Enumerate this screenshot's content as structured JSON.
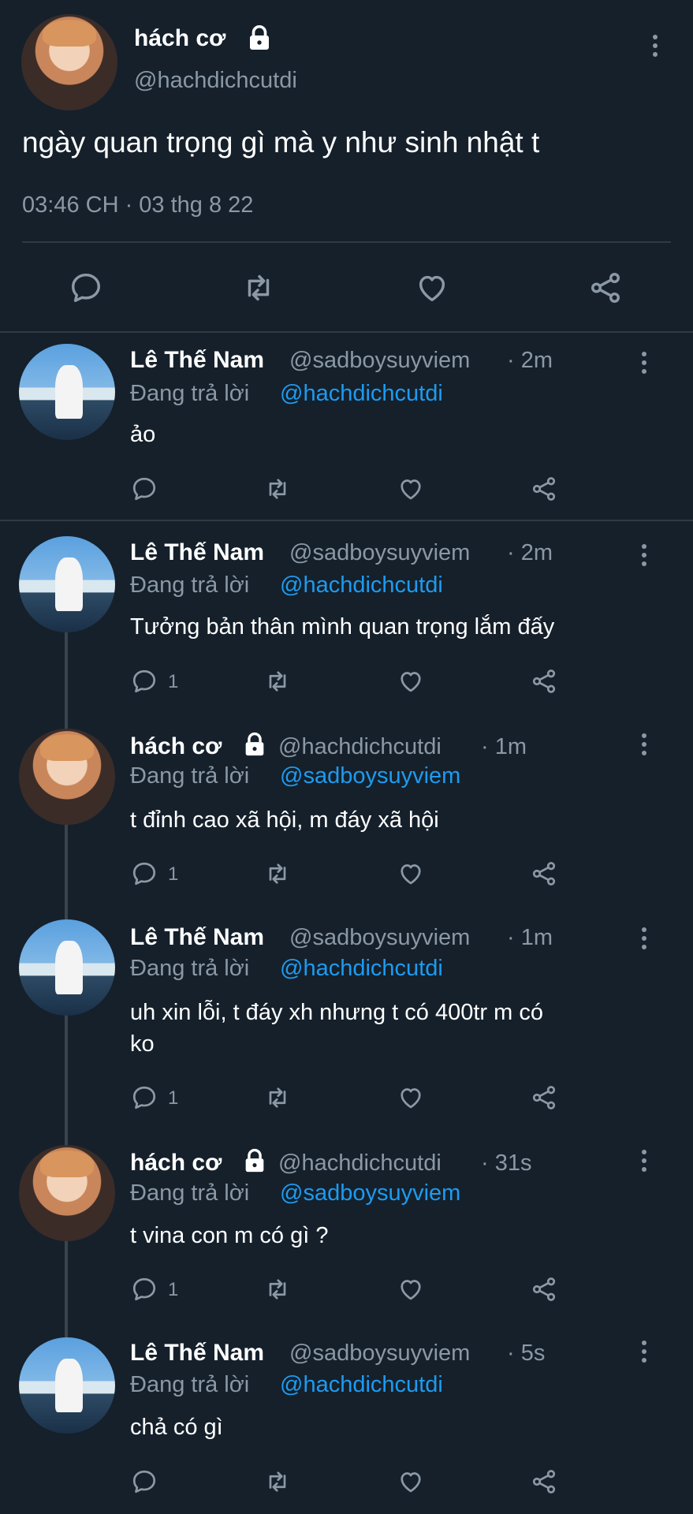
{
  "main_tweet": {
    "name": "hách cơ",
    "handle": "@hachdichcutdi",
    "text": "ngày quan trọng gì mà y như sinh nhật t",
    "timestamp": "03:46 CH · 03 thg 8 22",
    "more_icon": "more-vertical-icon",
    "lock_icon": "lock-icon"
  },
  "actions": {
    "reply_icon": "reply-icon",
    "retweet_icon": "retweet-icon",
    "like_icon": "heart-icon",
    "share_icon": "share-icon"
  },
  "colors": {
    "background": "#15202b",
    "muted": "#8b98a5",
    "link": "#1d9bf0",
    "separator": "#2f3a45"
  },
  "replies": [
    {
      "name": "Lê Thế Nam",
      "handle": "@sadboysuyviem",
      "time": "· 2m",
      "replying_prefix": "Đang trả lời",
      "replying_to": "@hachdichcutdi",
      "text": "ảo",
      "reply_count": ""
    },
    {
      "name": "Lê Thế Nam",
      "handle": "@sadboysuyviem",
      "time": "· 2m",
      "replying_prefix": "Đang trả lời",
      "replying_to": "@hachdichcutdi",
      "text": "Tưởng bản thân mình quan trọng lắm đấy",
      "reply_count": "1"
    },
    {
      "name": "hách cơ",
      "handle": "@hachdichcutdi",
      "time": "· 1m",
      "replying_prefix": "Đang trả lời",
      "replying_to": "@sadboysuyviem",
      "text": "t đỉnh cao xã hội, m đáy xã hội",
      "reply_count": "1"
    },
    {
      "name": "Lê Thế Nam",
      "handle": "@sadboysuyviem",
      "time": "· 1m",
      "replying_prefix": "Đang trả lời",
      "replying_to": "@hachdichcutdi",
      "text_line1": "uh xin lỗi, t đáy xh nhưng t có 400tr m có",
      "text_line2": "ko",
      "reply_count": "1"
    },
    {
      "name": "hách cơ",
      "handle": "@hachdichcutdi",
      "time": "· 31s",
      "replying_prefix": "Đang trả lời",
      "replying_to": "@sadboysuyviem",
      "text": "t vina con m có gì ?",
      "reply_count": "1"
    },
    {
      "name": "Lê Thế Nam",
      "handle": "@sadboysuyviem",
      "time": "· 5s",
      "replying_prefix": "Đang trả lời",
      "replying_to": "@hachdichcutdi",
      "text": "chả có gì",
      "reply_count": ""
    }
  ]
}
